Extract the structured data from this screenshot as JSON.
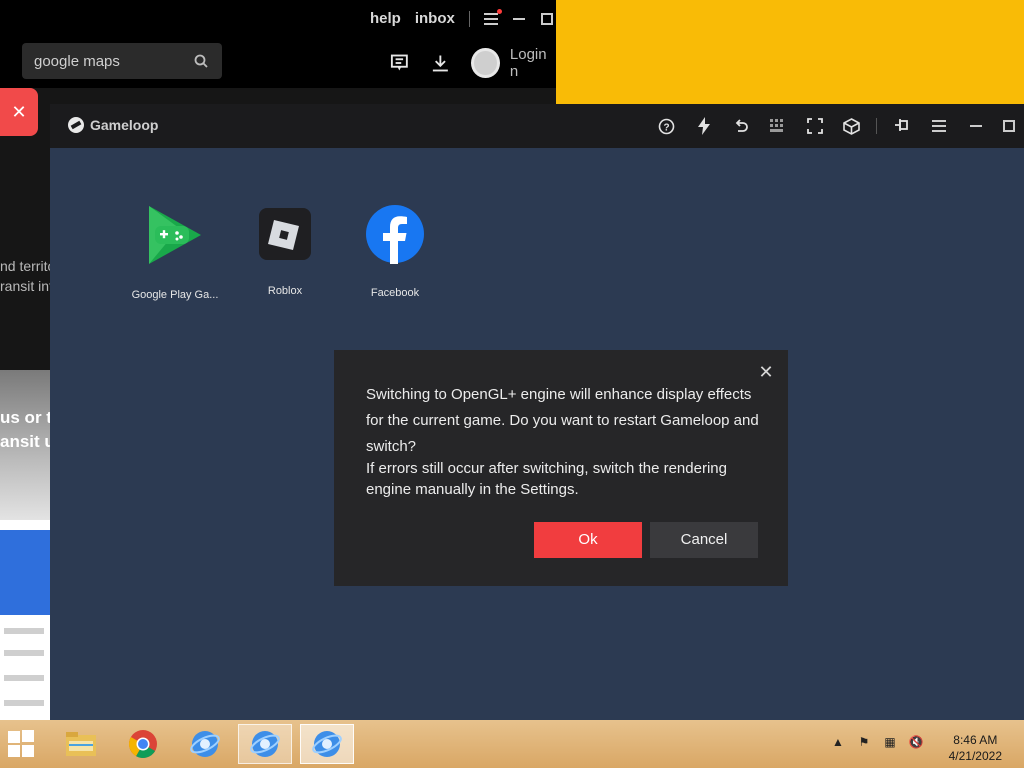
{
  "background_app": {
    "links": {
      "help": "help",
      "inbox": "inbox"
    },
    "search": {
      "value": "google maps"
    },
    "login_label": "Login n",
    "side_text_1": "nd territo",
    "side_text_2": "ransit inf",
    "photo_text_1": "us or tr",
    "photo_text_2": "ansit up"
  },
  "gameloop": {
    "title": "Gameloop",
    "apps": [
      {
        "label": "Google Play Ga...",
        "icon": "google-play-games-icon"
      },
      {
        "label": "Roblox",
        "icon": "roblox-icon"
      },
      {
        "label": "Facebook",
        "icon": "facebook-icon"
      }
    ],
    "toolbar_icons": [
      "help-icon",
      "boost-icon",
      "undo-icon",
      "keyboard-icon",
      "fullscreen-icon",
      "cube-icon",
      "pin-icon",
      "menu-icon",
      "minimize-icon",
      "maximize-icon"
    ]
  },
  "dialog": {
    "message": "Switching to OpenGL+ engine will enhance display effects for the current game. Do you want to restart Gameloop and switch?",
    "note": "If errors still occur after switching, switch the rendering engine manually in the Settings.",
    "ok_label": "Ok",
    "cancel_label": "Cancel"
  },
  "taskbar": {
    "time": "8:46 AM",
    "date": "4/21/2022",
    "items": [
      "start-button",
      "file-explorer-icon",
      "chrome-icon",
      "gameloop-icon",
      "gameloop-icon",
      "gameloop-icon"
    ]
  },
  "colors": {
    "accent_red": "#f13d3f",
    "yellow": "#f9bb06",
    "emulator_bg": "#2c3a52"
  }
}
